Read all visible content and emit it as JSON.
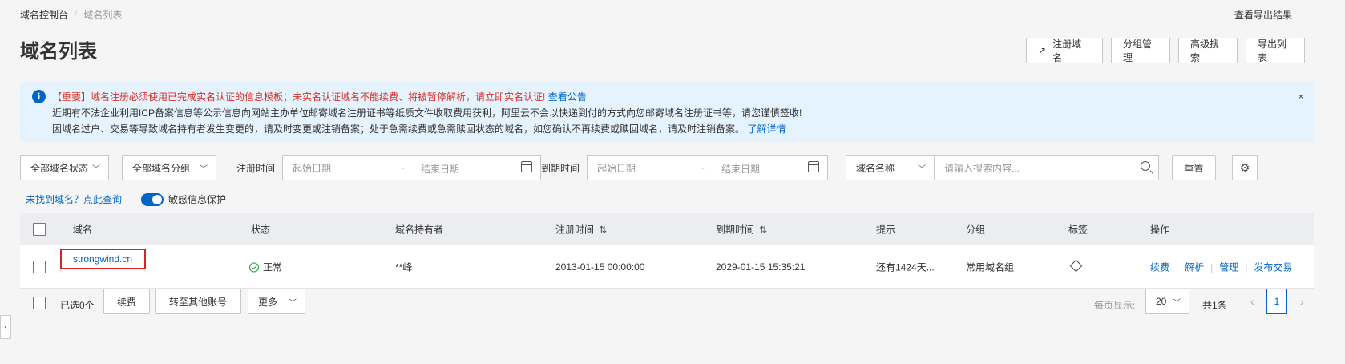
{
  "breadcrumb": {
    "root": "域名控制台",
    "separator": "/",
    "current": "域名列表"
  },
  "header": {
    "export_result": "查看导出结果",
    "title": "域名列表"
  },
  "actions": {
    "register": "注册域名",
    "group_manage": "分组管理",
    "advanced_search": "高级搜索",
    "export_list": "导出列表"
  },
  "notice": {
    "line1_red": "【重要】域名注册必须使用已完成实名认证的信息模板；未实名认证域名不能续费、将被暂停解析，请立即实名认证!",
    "line1_link": "查看公告",
    "line2": "近期有不法企业利用ICP备案信息等公示信息向网站主办单位邮寄域名注册证书等纸质文件收取费用获利，阿里云不会以快递到付的方式向您邮寄域名注册证书等，请您谨慎签收!",
    "line3": "因域名过户、交易等导致域名持有者发生变更的，请及时变更或注销备案；处于急需续费或急需赎回状态的域名，如您确认不再续费或赎回域名，请及时注销备案。",
    "line3_link": "了解详情",
    "close": "×"
  },
  "filters": {
    "status": "全部域名状态",
    "group": "全部域名分组",
    "reg_time_label": "注册时间",
    "exp_time_label": "到期时间",
    "start_placeholder": "起始日期",
    "end_placeholder": "结束日期",
    "range_sep": "-",
    "search_field": "域名名称",
    "search_placeholder": "请输入搜索内容...",
    "reset": "重置"
  },
  "toolbar": {
    "not_found": "未找到域名？点此查询",
    "sensitive_protect": "敏感信息保护"
  },
  "table": {
    "columns": {
      "domain": "域名",
      "status": "状态",
      "holder": "域名持有者",
      "reg_time": "注册时间",
      "exp_time": "到期时间",
      "hint": "提示",
      "group": "分组",
      "tag": "标签",
      "ops": "操作"
    },
    "rows": [
      {
        "domain": "strongwind.cn",
        "status": "正常",
        "holder": "**峰",
        "reg_time": "2013-01-15 00:00:00",
        "exp_time": "2029-01-15 15:35:21",
        "hint": "还有1424天...",
        "group": "常用域名组",
        "ops": [
          "续费",
          "解析",
          "管理",
          "发布交易"
        ]
      }
    ]
  },
  "footer": {
    "selected": "已选0个",
    "renew": "续费",
    "transfer": "转至其他账号",
    "more": "更多",
    "page_size_label": "每页显示:",
    "page_size": "20",
    "total": "共1条",
    "current_page": "1"
  },
  "colors": {
    "primary": "#0064c8",
    "notice_bg": "#e5f3ff",
    "alert_red": "#d93026",
    "success": "#1e9e46"
  }
}
